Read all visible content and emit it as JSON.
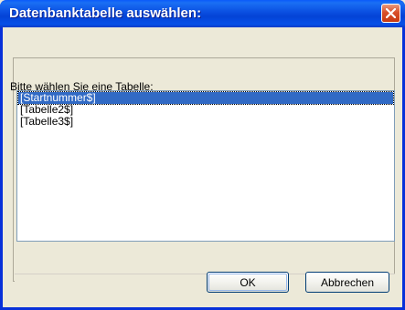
{
  "window": {
    "title": "Datenbanktabelle auswählen:",
    "close_icon": "close-icon"
  },
  "panel": {
    "label": "Bitte wählen Sie eine Tabelle:"
  },
  "list": {
    "items": [
      "[Startnummer$]",
      "[Tabelle2$]",
      "[Tabelle3$]"
    ],
    "selected_index": 0
  },
  "buttons": {
    "ok": "OK",
    "cancel": "Abbrechen"
  },
  "colors": {
    "titlebar": "#0a4ee0",
    "selection": "#316ac5",
    "dialog_bg": "#ece9d8",
    "close_button": "#d9502a"
  }
}
